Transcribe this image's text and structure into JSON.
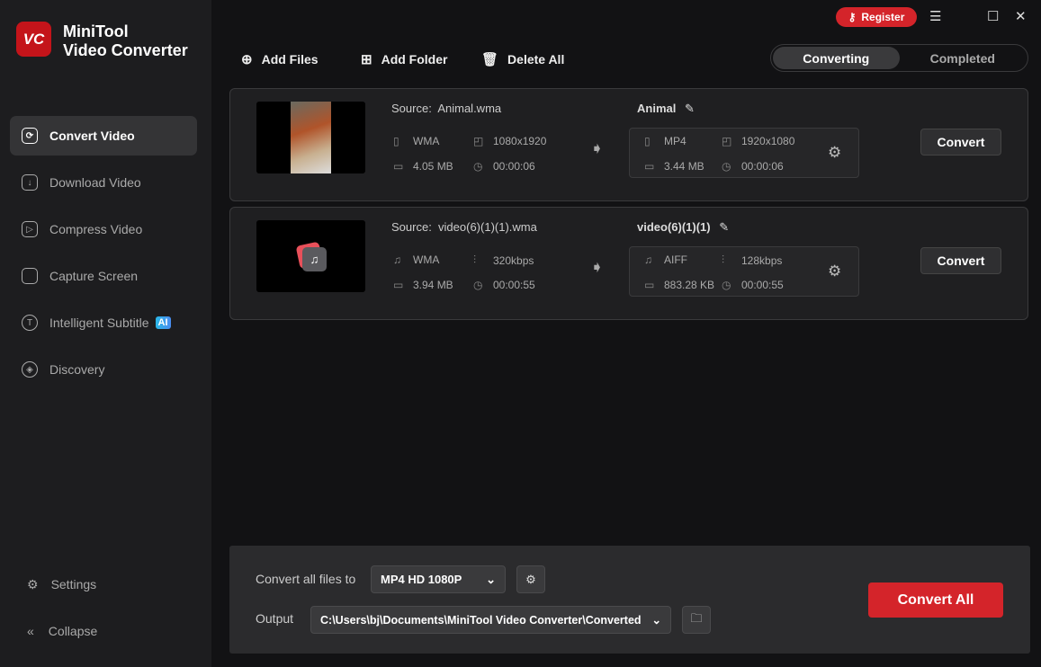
{
  "app": {
    "logo": "VC",
    "name_line1": "MiniTool",
    "name_line2": "Video Converter"
  },
  "sidebar": {
    "items": [
      {
        "label": "Convert Video",
        "icon": "convert-icon",
        "active": true
      },
      {
        "label": "Download Video",
        "icon": "download-icon"
      },
      {
        "label": "Compress Video",
        "icon": "compress-icon"
      },
      {
        "label": "Capture Screen",
        "icon": "camera-icon"
      },
      {
        "label": "Intelligent Subtitle",
        "icon": "subtitle-icon",
        "badge": "AI"
      },
      {
        "label": "Discovery",
        "icon": "compass-icon"
      }
    ],
    "settings": "Settings",
    "collapse": "Collapse"
  },
  "titlebar": {
    "register": "Register"
  },
  "toolbar": {
    "add_files": "Add Files",
    "add_folder": "Add Folder",
    "delete_all": "Delete All"
  },
  "tabs": {
    "converting": "Converting",
    "completed": "Completed"
  },
  "files": [
    {
      "source_label": "Source:",
      "source": "Animal.wma",
      "src_format": "WMA",
      "src_attr": "1080x1920",
      "src_size": "4.05 MB",
      "src_duration": "00:00:06",
      "target_name": "Animal",
      "tgt_format": "MP4",
      "tgt_attr": "1920x1080",
      "tgt_size": "3.44 MB",
      "tgt_duration": "00:00:06",
      "convert": "Convert"
    },
    {
      "source_label": "Source:",
      "source": "video(6)(1)(1).wma",
      "src_format": "WMA",
      "src_attr": "320kbps",
      "src_size": "3.94 MB",
      "src_duration": "00:00:55",
      "target_name": "video(6)(1)(1)",
      "tgt_format": "AIFF",
      "tgt_attr": "128kbps",
      "tgt_size": "883.28 KB",
      "tgt_duration": "00:00:55",
      "convert": "Convert"
    }
  ],
  "bottom": {
    "convert_all_to_label": "Convert all files to",
    "format": "MP4 HD 1080P",
    "output_label": "Output",
    "output_path": "C:\\Users\\bj\\Documents\\MiniTool Video Converter\\Converted",
    "convert_all": "Convert All"
  },
  "colors": {
    "accent": "#d4242a"
  }
}
